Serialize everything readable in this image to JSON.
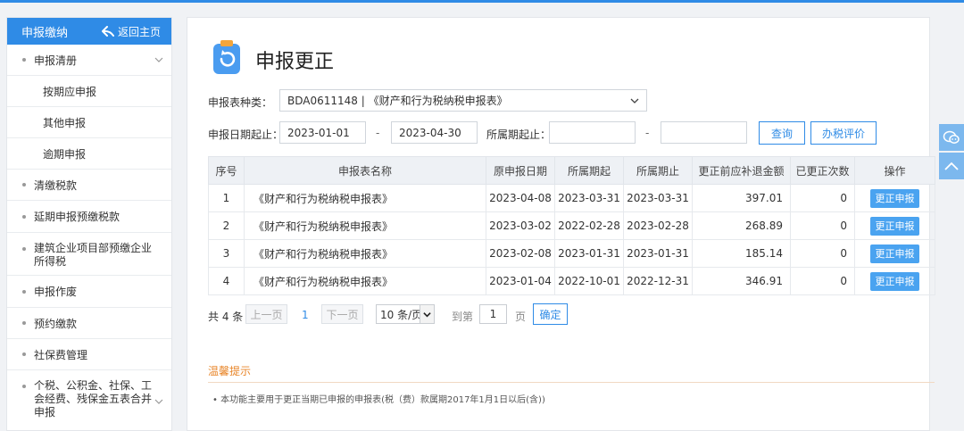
{
  "sidebar": {
    "title": "申报缴纳",
    "back_label": "返回主页",
    "items": [
      {
        "label": "申报清册"
      },
      {
        "label": "清缴税款"
      },
      {
        "label": "延期申报预缴税款"
      },
      {
        "label": "建筑企业项目部预缴企业",
        "label2": "所得税"
      },
      {
        "label": "申报作废"
      },
      {
        "label": "预约缴款"
      },
      {
        "label": "社保费管理"
      },
      {
        "label": "个税、公积金、社保、工",
        "label2": "会经费、残保金五表合并",
        "label3": "申报"
      }
    ],
    "subitems": [
      {
        "label": "按期应申报"
      },
      {
        "label": "其他申报"
      },
      {
        "label": "逾期申报"
      }
    ]
  },
  "page": {
    "title": "申报更正"
  },
  "form": {
    "type_label": "申报表种类：",
    "type_value": "BDA0611148 | 《财产和行为税纳税申报表》",
    "date_label": "申报日期起止：",
    "date_from": "2023-01-01",
    "date_sep": "-",
    "date_to": "2023-04-30",
    "period_label": "所属期起止：",
    "period_from": "",
    "period_sep": "-",
    "period_to": "",
    "query_button": "查询",
    "eval_button": "办税评价"
  },
  "table": {
    "headers": [
      "序号",
      "申报表名称",
      "原申报日期",
      "所属期起",
      "所属期止",
      "更正前应补退金额",
      "已更正次数",
      "操作"
    ],
    "rows": [
      {
        "no": "1",
        "name": "《财产和行为税纳税申报表》",
        "date": "2023-04-08",
        "start": "2023-03-31",
        "end": "2023-03-31",
        "amount": "397.01",
        "count": "0",
        "action": "更正申报"
      },
      {
        "no": "2",
        "name": "《财产和行为税纳税申报表》",
        "date": "2023-03-02",
        "start": "2022-02-28",
        "end": "2023-02-28",
        "amount": "268.89",
        "count": "0",
        "action": "更正申报"
      },
      {
        "no": "3",
        "name": "《财产和行为税纳税申报表》",
        "date": "2023-02-08",
        "start": "2023-01-31",
        "end": "2023-01-31",
        "amount": "185.14",
        "count": "0",
        "action": "更正申报"
      },
      {
        "no": "4",
        "name": "《财产和行为税纳税申报表》",
        "date": "2023-01-04",
        "start": "2022-10-01",
        "end": "2022-12-31",
        "amount": "346.91",
        "count": "0",
        "action": "更正申报"
      }
    ]
  },
  "pagination": {
    "total": "共 4 条",
    "prev": "上一页",
    "current": "1",
    "next": "下一页",
    "page_size": "10 条/页",
    "goto_label": "到第",
    "goto_value": "1",
    "page_unit": "页",
    "confirm": "确定"
  },
  "tips": {
    "title": "温馨提示",
    "text": "•  本功能主要用于更正当期已申报的申报表(税（费）款属期2017年1月1日以后(含))"
  },
  "colors": {
    "primary": "#2f8be6",
    "tips": "#e8862a"
  },
  "icons": {
    "back": "back-arrow-icon",
    "chat": "chat-icon",
    "top": "back-to-top-icon"
  }
}
